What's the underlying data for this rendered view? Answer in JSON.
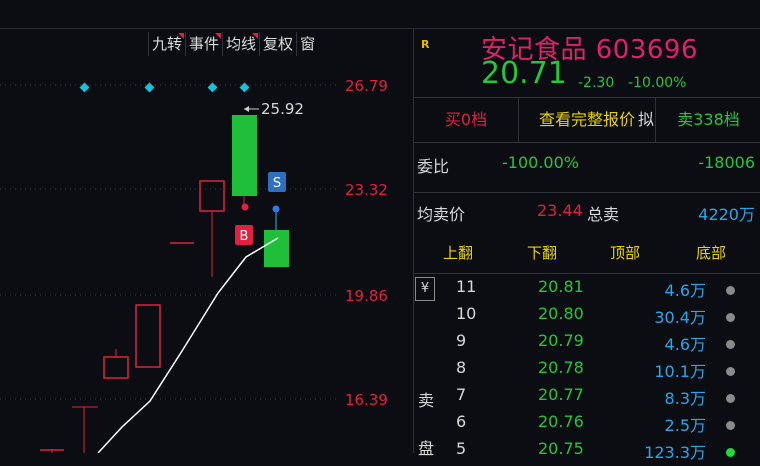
{
  "toolbar": {
    "items": [
      "九转",
      "事件",
      "均线",
      "复权",
      "窗"
    ]
  },
  "chart": {
    "price_levels": [
      "26.79",
      "23.32",
      "19.86",
      "16.39"
    ],
    "high_annotation": "25.92",
    "marker_s": "S",
    "marker_b": "B",
    "colors": {
      "up": "#e0213f",
      "down": "#1fbf3a",
      "line": "#ffffff",
      "diamond": "#17c1d8",
      "axis_text": "#e0213f"
    }
  },
  "quote": {
    "tag": "R",
    "name": "安记食品 603696",
    "price": "20.71",
    "change": "-2.30",
    "change_pct": "-10.00%",
    "buy_levels": "买0档",
    "view_full": "查看完整报价",
    "sell_levels": "卖338档",
    "mini_label": "拟",
    "wei_bi_label": "委比",
    "wei_bi_value": "-100.00%",
    "wei_cha_value": "-18006",
    "avg_sell_label": "均卖价",
    "avg_sell_value": "23.44",
    "total_sell_label": "总卖",
    "total_sell_value": "4220万",
    "tabs": [
      "上翻",
      "下翻",
      "顶部",
      "底部"
    ],
    "currency_mark": "¥",
    "side_label_1": "卖",
    "side_label_2": "盘"
  },
  "order_book": [
    {
      "level": "11",
      "price": "20.81",
      "volume": "4.6万",
      "status": "gray"
    },
    {
      "level": "10",
      "price": "20.80",
      "volume": "30.4万",
      "status": "gray"
    },
    {
      "level": "9",
      "price": "20.79",
      "volume": "4.6万",
      "status": "gray"
    },
    {
      "level": "8",
      "price": "20.78",
      "volume": "10.1万",
      "status": "gray"
    },
    {
      "level": "7",
      "price": "20.77",
      "volume": "8.3万",
      "status": "gray"
    },
    {
      "level": "6",
      "price": "20.76",
      "volume": "2.5万",
      "status": "gray"
    },
    {
      "level": "5",
      "price": "20.75",
      "volume": "123.3万",
      "status": "green"
    }
  ]
}
